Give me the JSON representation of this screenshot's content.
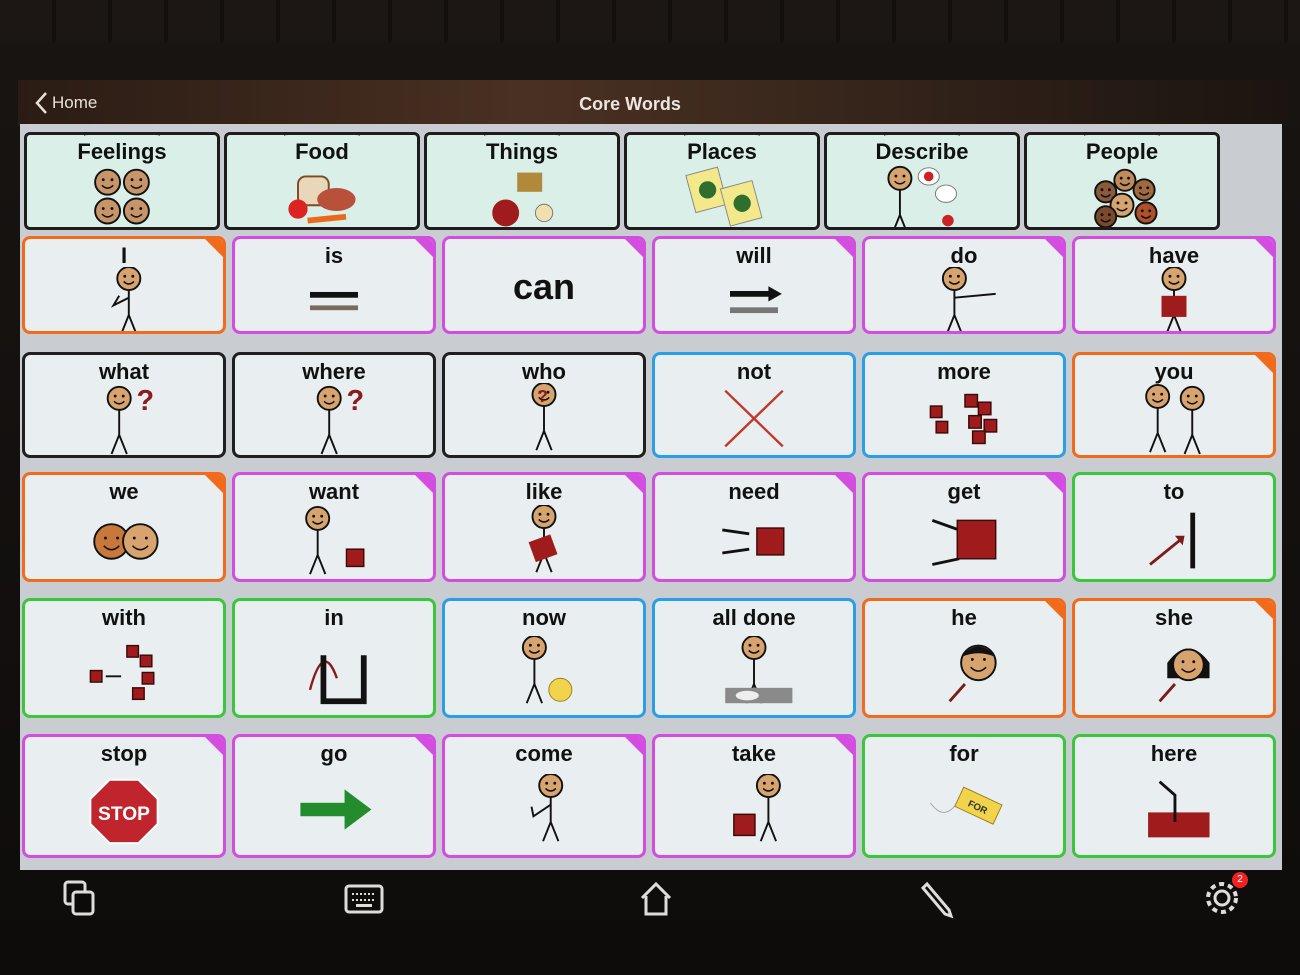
{
  "header": {
    "back_label": "Home",
    "title": "Core Words"
  },
  "colors": {
    "pronoun": "#f26a1b",
    "verb": "#d24de0",
    "question": "#1f1f1f",
    "adverb": "#2b9fe6",
    "preposition": "#3cc63c",
    "folder": "#d9efe8"
  },
  "folders": [
    {
      "label": "Feelings",
      "icon": "faces-icon"
    },
    {
      "label": "Food",
      "icon": "food-icon"
    },
    {
      "label": "Things",
      "icon": "things-icon"
    },
    {
      "label": "Places",
      "icon": "maps-icon"
    },
    {
      "label": "Describe",
      "icon": "describe-icon"
    },
    {
      "label": "People",
      "icon": "people-icon"
    }
  ],
  "rows": [
    [
      {
        "label": "I",
        "cat": "pronoun",
        "corner": true,
        "icon": "person-pointing-self-icon"
      },
      {
        "label": "is",
        "cat": "verb",
        "corner": true,
        "icon": "equals-icon"
      },
      {
        "label": "can",
        "cat": "verb",
        "corner": true,
        "icon": "",
        "big": true
      },
      {
        "label": "will",
        "cat": "verb",
        "corner": true,
        "icon": "arrow-equals-icon"
      },
      {
        "label": "do",
        "cat": "verb",
        "corner": true,
        "icon": "person-reaching-icon"
      },
      {
        "label": "have",
        "cat": "verb",
        "corner": true,
        "icon": "person-holding-icon"
      }
    ],
    [
      {
        "label": "what",
        "cat": "question",
        "corner": false,
        "icon": "person-shrug-question-icon"
      },
      {
        "label": "where",
        "cat": "question",
        "corner": false,
        "icon": "person-looking-question-icon"
      },
      {
        "label": "who",
        "cat": "question",
        "corner": false,
        "icon": "person-question-face-icon"
      },
      {
        "label": "not",
        "cat": "adverb",
        "corner": false,
        "icon": "cross-icon"
      },
      {
        "label": "more",
        "cat": "adverb",
        "corner": false,
        "icon": "blocks-more-icon"
      },
      {
        "label": "you",
        "cat": "pronoun",
        "corner": true,
        "icon": "two-people-pointing-icon"
      }
    ],
    [
      {
        "label": "we",
        "cat": "pronoun",
        "corner": true,
        "icon": "two-faces-icon"
      },
      {
        "label": "want",
        "cat": "verb",
        "corner": true,
        "icon": "person-reaching-block-icon"
      },
      {
        "label": "like",
        "cat": "verb",
        "corner": true,
        "icon": "person-hugging-block-icon"
      },
      {
        "label": "need",
        "cat": "verb",
        "corner": true,
        "icon": "hands-block-icon"
      },
      {
        "label": "get",
        "cat": "verb",
        "corner": true,
        "icon": "hands-grab-block-icon"
      },
      {
        "label": "to",
        "cat": "preposition",
        "corner": false,
        "icon": "arrow-to-line-icon"
      }
    ],
    [
      {
        "label": "with",
        "cat": "preposition",
        "corner": false,
        "icon": "blocks-join-icon"
      },
      {
        "label": "in",
        "cat": "preposition",
        "corner": false,
        "icon": "arrow-into-box-icon"
      },
      {
        "label": "now",
        "cat": "adverb",
        "corner": false,
        "icon": "person-clock-icon"
      },
      {
        "label": "all done",
        "cat": "adverb",
        "corner": false,
        "icon": "person-finished-icon"
      },
      {
        "label": "he",
        "cat": "pronoun",
        "corner": true,
        "icon": "boy-face-icon"
      },
      {
        "label": "she",
        "cat": "pronoun",
        "corner": true,
        "icon": "girl-face-icon"
      }
    ],
    [
      {
        "label": "stop",
        "cat": "verb",
        "corner": true,
        "icon": "stop-sign-icon",
        "sign_text": "STOP"
      },
      {
        "label": "go",
        "cat": "verb",
        "corner": true,
        "icon": "green-arrow-icon"
      },
      {
        "label": "come",
        "cat": "verb",
        "corner": true,
        "icon": "person-beckoning-icon"
      },
      {
        "label": "take",
        "cat": "verb",
        "corner": true,
        "icon": "person-taking-icon"
      },
      {
        "label": "for",
        "cat": "preposition",
        "corner": false,
        "icon": "tag-icon",
        "tag_text": "FOR"
      },
      {
        "label": "here",
        "cat": "preposition",
        "corner": false,
        "icon": "pointing-here-icon"
      }
    ]
  ],
  "navbar": {
    "items": [
      {
        "name": "pages-icon"
      },
      {
        "name": "keyboard-icon"
      },
      {
        "name": "home-icon"
      },
      {
        "name": "pencil-icon"
      },
      {
        "name": "gear-icon",
        "badge": "2"
      }
    ]
  }
}
